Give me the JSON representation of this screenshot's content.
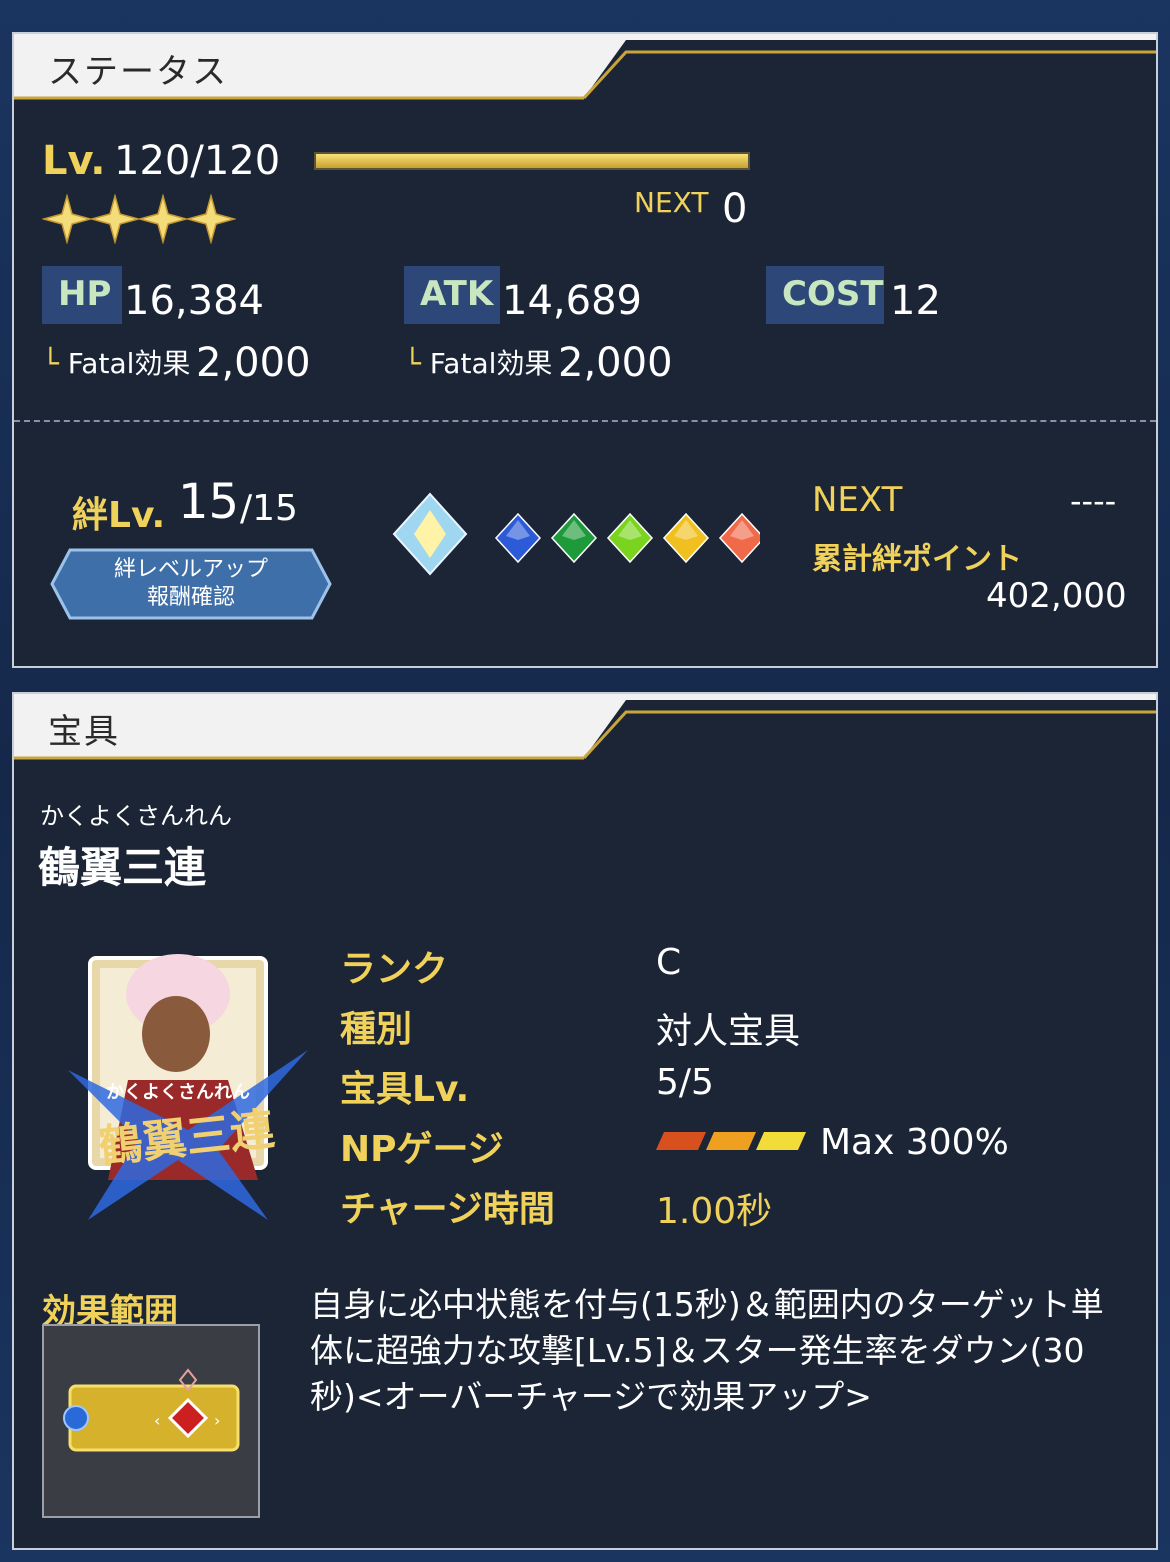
{
  "status": {
    "header": "ステータス",
    "level_label": "Lv.",
    "level_value": "120/120",
    "level_progress": 1.0,
    "next_label": "NEXT",
    "next_value": "0",
    "stars": 4,
    "hp_label": "HP",
    "hp_value": "16,384",
    "atk_label": "ATK",
    "atk_value": "14,689",
    "cost_label": "COST",
    "cost_value": "12",
    "fatal_hp_label": "Fatal効果",
    "fatal_hp_value": "2,000",
    "fatal_atk_label": "Fatal効果",
    "fatal_atk_value": "2,000",
    "bond_label": "絆Lv.",
    "bond_current": "15",
    "bond_max": "/15",
    "bond_button_line1": "絆レベルアップ",
    "bond_button_line2": "報酬確認",
    "bond_next_label": "NEXT",
    "bond_next_value": "----",
    "bond_total_label": "累計絆ポイント",
    "bond_total_value": "402,000",
    "gem_colors": [
      "#2d5bd8",
      "#1f9a3a",
      "#7ad41e",
      "#f0c020",
      "#f06a4a"
    ]
  },
  "noble_phantasm": {
    "header": "宝具",
    "ruby": "かくよくさんれん",
    "name": "鶴翼三連",
    "card_ruby": "かくよくさんれん",
    "card_name": "鶴翼三連",
    "rank_label": "ランク",
    "rank_value": "C",
    "type_label": "種別",
    "type_value": "対人宝具",
    "np_level_label": "宝具Lv.",
    "np_level_value": "5/5",
    "gauge_label": "NPゲージ",
    "gauge_value": "Max 300%",
    "charge_label": "チャージ時間",
    "charge_value": "1.00秒",
    "range_label": "効果範囲",
    "description": "自身に必中状態を付与(15秒)＆範囲内のターゲット単体に超強力な攻撃[Lv.5]＆スター発生率をダウン(30秒)<オーバーチャージで効果アップ>"
  }
}
